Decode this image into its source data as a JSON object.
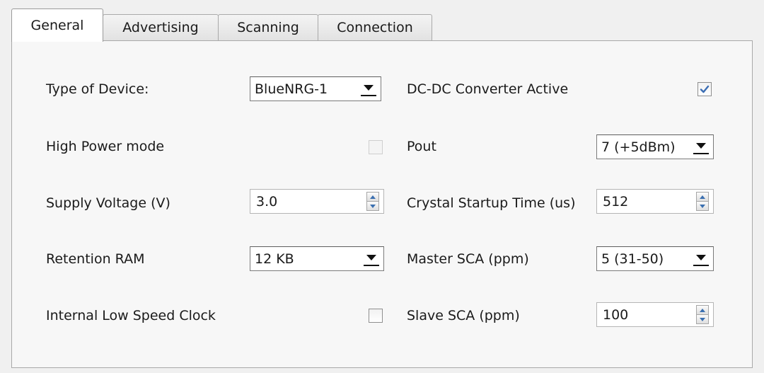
{
  "tabs": [
    {
      "label": "General",
      "active": true
    },
    {
      "label": "Advertising",
      "active": false
    },
    {
      "label": "Scanning",
      "active": false
    },
    {
      "label": "Connection",
      "active": false
    }
  ],
  "general": {
    "type_of_device": {
      "label": "Type of Device:",
      "value": "BlueNRG-1"
    },
    "high_power_mode": {
      "label": "High Power mode",
      "checked": false,
      "enabled": false
    },
    "supply_voltage": {
      "label": "Supply Voltage (V)",
      "value": "3.0"
    },
    "retention_ram": {
      "label": "Retention RAM",
      "value": "12 KB"
    },
    "internal_low_speed_clock": {
      "label": "Internal Low Speed Clock",
      "checked": false
    },
    "dcdc_converter_active": {
      "label": "DC-DC Converter Active",
      "checked": true
    },
    "pout": {
      "label": "Pout",
      "value": "7 (+5dBm)"
    },
    "crystal_startup_time": {
      "label": "Crystal Startup Time (us)",
      "value": "512"
    },
    "master_sca": {
      "label": "Master SCA (ppm)",
      "value": "5 (31-50)"
    },
    "slave_sca": {
      "label": "Slave SCA (ppm)",
      "value": "100"
    }
  },
  "colors": {
    "checkmark": "#3b6db3"
  }
}
